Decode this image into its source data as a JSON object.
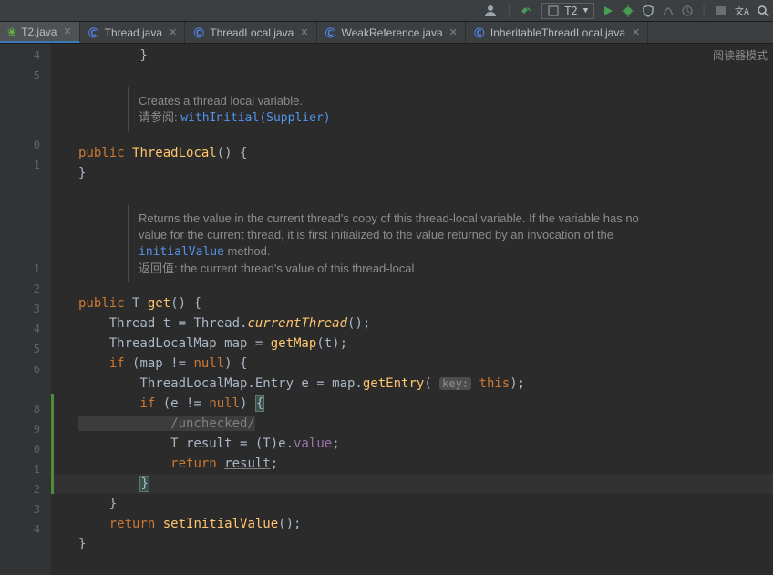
{
  "toolbar": {
    "run_config": "T2"
  },
  "tabs": [
    {
      "label": "T2.java",
      "icon": "leaf",
      "active": true
    },
    {
      "label": "Thread.java",
      "icon": "class",
      "active": false
    },
    {
      "label": "ThreadLocal.java",
      "icon": "class",
      "active": false
    },
    {
      "label": "WeakReference.java",
      "icon": "class",
      "active": false
    },
    {
      "label": "InheritableThreadLocal.java",
      "icon": "class",
      "active": false
    }
  ],
  "reader_mode": "阅读器模式",
  "line_numbers": [
    "4",
    "5",
    "",
    "0",
    "1",
    "",
    "",
    "1",
    "2",
    "3",
    "4",
    "5",
    "6",
    "",
    "8",
    "9",
    "0",
    "1",
    "2",
    "3",
    "4"
  ],
  "doc1": {
    "l1": "Creates a thread local variable.",
    "l2_pre": "请参阅: ",
    "l2_link": "withInitial(Supplier)"
  },
  "doc2": {
    "l1": "Returns the value in the current thread's copy of this thread-local variable. If the variable has no",
    "l2": "value for the current thread, it is first initialized to the value returned by an invocation of the",
    "l3_link": "initialValue",
    "l3_post": " method.",
    "l4": "返回值: the current thread's value of this thread-local"
  },
  "code": {
    "top_close": "        }",
    "ctor_sig": {
      "kw1": "public ",
      "name": "ThreadLocal",
      "after": "() {"
    },
    "ctor_close": "}",
    "get_sig": {
      "kw": "public ",
      "t": "T ",
      "n": "get",
      "a": "() {"
    },
    "g1": {
      "a": "    Thread t = Thread.",
      "b": "currentThread",
      "c": "();"
    },
    "g2": {
      "a": "    ThreadLocalMap map = ",
      "b": "getMap",
      "c": "(t);"
    },
    "g3": {
      "a": "    ",
      "kw": "if ",
      "b": "(map != ",
      "nl": "null",
      "c": ") {"
    },
    "g4": {
      "a": "        ThreadLocalMap.Entry e = map.",
      "b": "getEntry",
      "c": "( ",
      "hint": "key:",
      "d": " ",
      "th": "this",
      "e": ");"
    },
    "g5": {
      "a": "        ",
      "kw": "if ",
      "b": "(e != ",
      "nl": "null",
      "c": ") ",
      "br": "{"
    },
    "g6": "            /unchecked/",
    "g7": {
      "a": "            T result = (",
      "t": "T",
      "b": ")e.",
      "v": "value",
      "c": ";"
    },
    "g8": {
      "a": "            ",
      "kw": "return ",
      "r": "result",
      "c": ";"
    },
    "g9": {
      "a": "        ",
      "br": "}"
    },
    "g10": "    }",
    "g11": {
      "a": "    ",
      "kw": "return ",
      "m": "setInitialValue",
      "c": "();"
    },
    "g12": "}"
  }
}
